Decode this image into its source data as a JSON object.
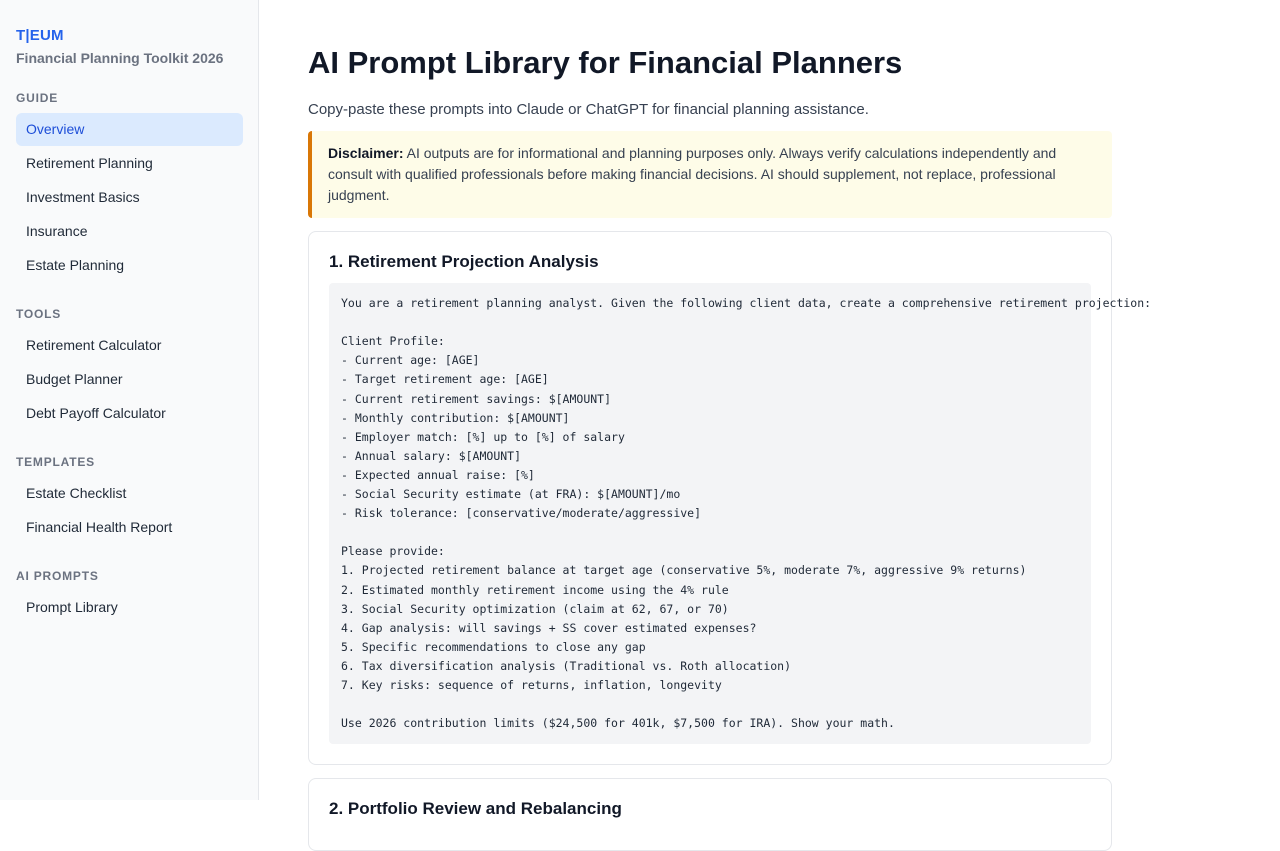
{
  "sidebar": {
    "brand": "T|EUM",
    "subtitle": "Financial Planning Toolkit 2026",
    "sections": [
      {
        "label": "GUIDE",
        "items": [
          "Overview",
          "Retirement Planning",
          "Investment Basics",
          "Insurance",
          "Estate Planning"
        ]
      },
      {
        "label": "TOOLS",
        "items": [
          "Retirement Calculator",
          "Budget Planner",
          "Debt Payoff Calculator"
        ]
      },
      {
        "label": "TEMPLATES",
        "items": [
          "Estate Checklist",
          "Financial Health Report"
        ]
      },
      {
        "label": "AI PROMPTS",
        "items": [
          "Prompt Library"
        ]
      }
    ]
  },
  "main": {
    "title": "AI Prompt Library for Financial Planners",
    "intro": "Copy-paste these prompts into Claude or ChatGPT for financial planning assistance.",
    "disclaimer_label": "Disclaimer:",
    "disclaimer_text": " AI outputs are for informational and planning purposes only. Always verify calculations independently and consult with qualified professionals before making financial decisions. AI should supplement, not replace, professional judgment.",
    "prompts": [
      {
        "title": "1. Retirement Projection Analysis",
        "body": "You are a retirement planning analyst. Given the following client data, create a comprehensive retirement projection:\n\nClient Profile:\n- Current age: [AGE]\n- Target retirement age: [AGE]\n- Current retirement savings: $[AMOUNT]\n- Monthly contribution: $[AMOUNT]\n- Employer match: [%] up to [%] of salary\n- Annual salary: $[AMOUNT]\n- Expected annual raise: [%]\n- Social Security estimate (at FRA): $[AMOUNT]/mo\n- Risk tolerance: [conservative/moderate/aggressive]\n\nPlease provide:\n1. Projected retirement balance at target age (conservative 5%, moderate 7%, aggressive 9% returns)\n2. Estimated monthly retirement income using the 4% rule\n3. Social Security optimization (claim at 62, 67, or 70)\n4. Gap analysis: will savings + SS cover estimated expenses?\n5. Specific recommendations to close any gap\n6. Tax diversification analysis (Traditional vs. Roth allocation)\n7. Key risks: sequence of returns, inflation, longevity\n\nUse 2026 contribution limits ($24,500 for 401k, $7,500 for IRA). Show your math."
      },
      {
        "title": "2. Portfolio Review and Rebalancing",
        "body": ""
      }
    ]
  }
}
